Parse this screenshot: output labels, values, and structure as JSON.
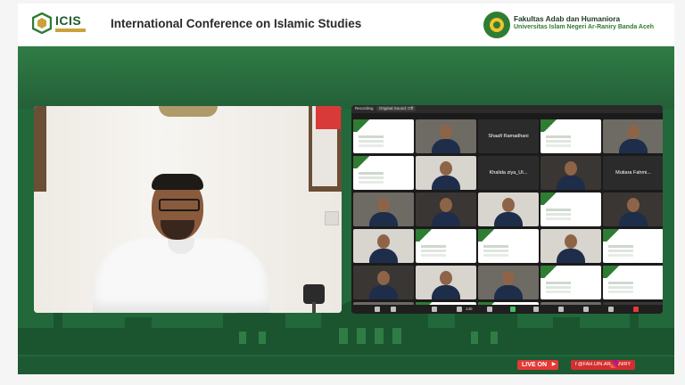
{
  "header": {
    "logo_text": "ICIS",
    "title": "International Conference on Islamic Studies",
    "faculty_line1": "Fakultas Adab dan Humaniora",
    "faculty_line2": "Universitas Islam Negeri Ar-Raniry Banda Aceh"
  },
  "zoom": {
    "top_label": "Recording",
    "top_chip": "Original Sound: Off",
    "participants_count": "140",
    "tiles": [
      {
        "type": "slide",
        "name": ""
      },
      {
        "type": "video",
        "name": ""
      },
      {
        "type": "name",
        "name": "Shaafi Ramadhani"
      },
      {
        "type": "slide",
        "name": ""
      },
      {
        "type": "video",
        "name": ""
      },
      {
        "type": "slide",
        "name": ""
      },
      {
        "type": "video",
        "name": ""
      },
      {
        "type": "name",
        "name": "Khalida ziya_UI..."
      },
      {
        "type": "video",
        "name": ""
      },
      {
        "type": "name",
        "name": "Mutiara Fahmi..."
      },
      {
        "type": "video",
        "name": ""
      },
      {
        "type": "video",
        "name": ""
      },
      {
        "type": "video",
        "name": ""
      },
      {
        "type": "slide",
        "name": ""
      },
      {
        "type": "video",
        "name": ""
      },
      {
        "type": "video",
        "name": ""
      },
      {
        "type": "slide",
        "name": ""
      },
      {
        "type": "slide",
        "name": ""
      },
      {
        "type": "video",
        "name": ""
      },
      {
        "type": "slide",
        "name": ""
      },
      {
        "type": "video",
        "name": ""
      },
      {
        "type": "video",
        "name": ""
      },
      {
        "type": "video",
        "name": ""
      },
      {
        "type": "slide",
        "name": ""
      },
      {
        "type": "slide",
        "name": ""
      },
      {
        "type": "video",
        "name": ""
      },
      {
        "type": "slide",
        "name": ""
      },
      {
        "type": "slide",
        "name": ""
      },
      {
        "type": "video",
        "name": ""
      },
      {
        "type": "video",
        "name": ""
      }
    ]
  },
  "footer": {
    "live_label": "LIVE ON",
    "social_handle": "f @FAH.UIN.AR-RANIRY"
  },
  "colors": {
    "brand_green": "#22683a",
    "accent_gold": "#c8a23a",
    "live_red": "#e53935"
  },
  "icons": [
    "icis-logo-icon",
    "uin-logo-icon",
    "youtube-icon",
    "instagram-icon",
    "microphone-icon",
    "zoom-toolbar-icons"
  ]
}
